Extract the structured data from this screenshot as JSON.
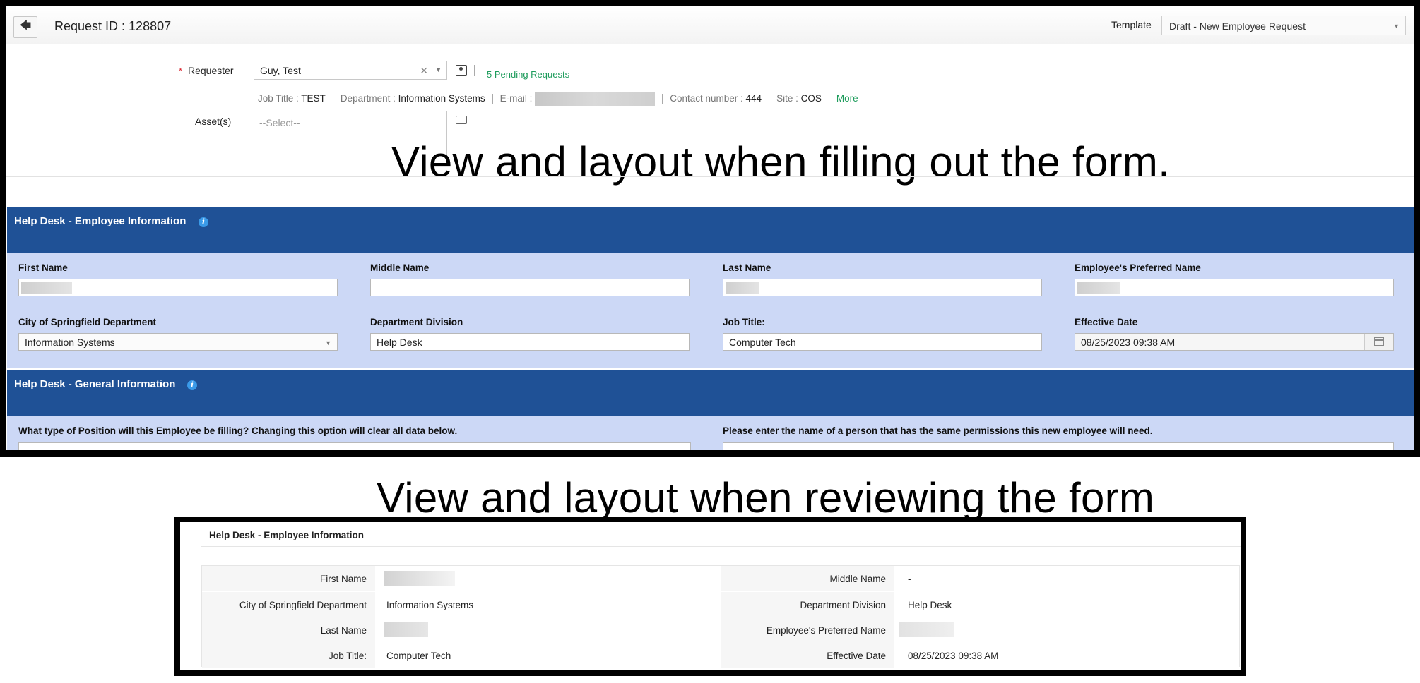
{
  "header": {
    "request_id": "Request ID : 128807",
    "template_label": "Template",
    "template_value": "Draft - New Employee Request"
  },
  "requester": {
    "label": "Requester",
    "value": "Guy, Test",
    "pending": "5 Pending Requests",
    "job_title_label": "Job Title :",
    "job_title": "TEST",
    "department_label": "Department :",
    "department": "Information Systems",
    "email_label": "E-mail :",
    "contact_label": "Contact number :",
    "contact": "444",
    "site_label": "Site :",
    "site": "COS",
    "more": "More"
  },
  "assets": {
    "label": "Asset(s)",
    "placeholder": "--Select--"
  },
  "annotations": {
    "top": "View and layout when filling out the form.",
    "bottom": "View and layout when reviewing the form"
  },
  "employee_section": {
    "title": "Help Desk - Employee Information",
    "first_name_label": "First Name",
    "middle_name_label": "Middle Name",
    "last_name_label": "Last Name",
    "preferred_name_label": "Employee's Preferred Name",
    "department_label": "City of Springfield Department",
    "department_value": "Information Systems",
    "division_label": "Department Division",
    "division_value": "Help Desk",
    "job_title_label": "Job Title:",
    "job_title_value": "Computer Tech",
    "effective_date_label": "Effective Date",
    "effective_date_value": "08/25/2023 09:38 AM"
  },
  "general_section": {
    "title": "Help Desk - General Information",
    "position_question": "What type of Position will this Employee be filling? Changing this option will clear all data below.",
    "permissions_question": "Please enter the name of a person that has the same permissions this new employee will need."
  },
  "review": {
    "title": "Help Desk - Employee Information",
    "first_name_label": "First Name",
    "middle_name_label": "Middle Name",
    "middle_name_value": "-",
    "department_label": "City of Springfield Department",
    "department_value": "Information Systems",
    "division_label": "Department Division",
    "division_value": "Help Desk",
    "last_name_label": "Last Name",
    "preferred_name_label": "Employee's Preferred Name",
    "job_title_label": "Job Title:",
    "job_title_value": "Computer Tech",
    "effective_date_label": "Effective Date",
    "effective_date_value": "08/25/2023 09:38 AM",
    "next_section_title": "Help Desk - General Information"
  }
}
